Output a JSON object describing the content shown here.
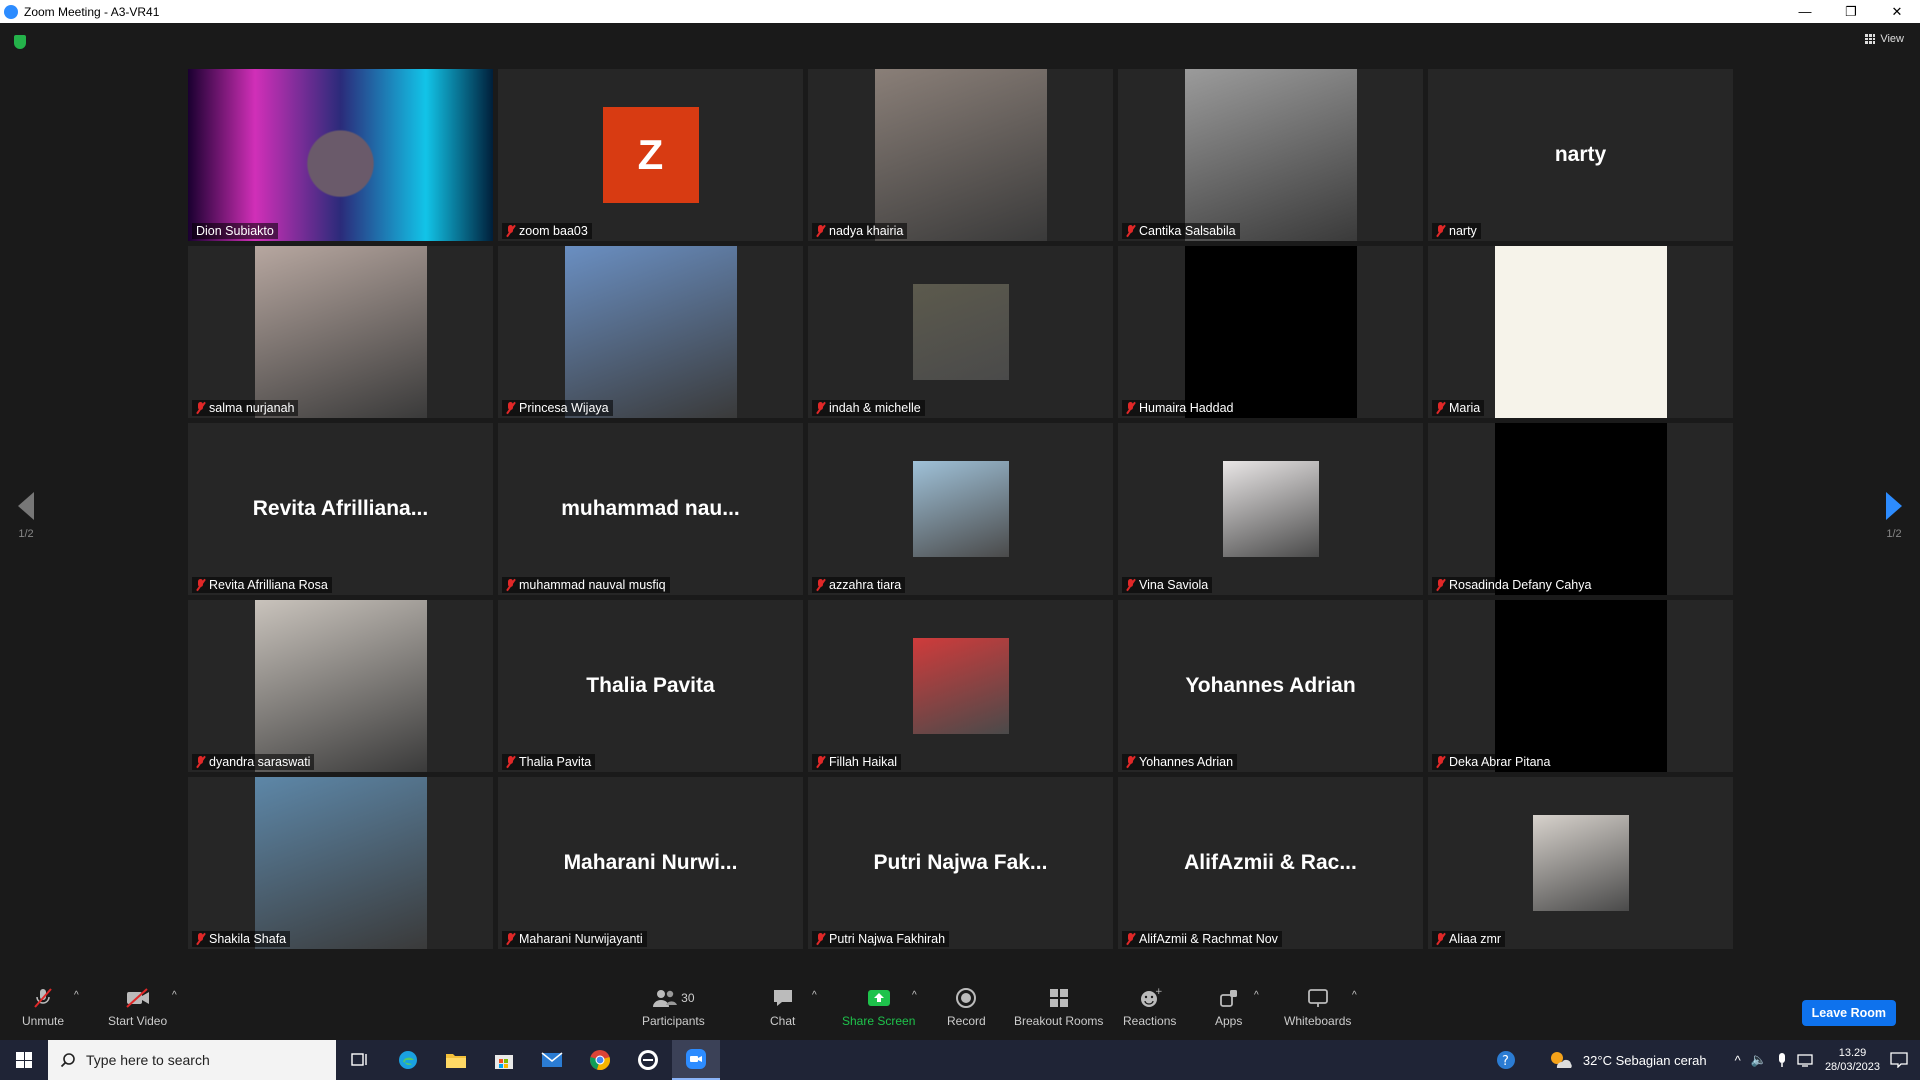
{
  "window": {
    "title": "Zoom Meeting - A3-VR41",
    "controls": [
      "—",
      "❐",
      "✕"
    ]
  },
  "header": {
    "view_label": "View"
  },
  "pager": {
    "left": "1/2",
    "right": "1/2"
  },
  "participants": [
    {
      "name": "Dion Subiakto",
      "display": "",
      "type": "video-neon",
      "muted": false,
      "active": true
    },
    {
      "name": "zoom baa03",
      "display": "",
      "type": "avatar",
      "initial": "Z",
      "muted": true
    },
    {
      "name": "nadya khairia",
      "display": "",
      "type": "video",
      "color": "#8a7f78",
      "muted": true
    },
    {
      "name": "Cantika Salsabila",
      "display": "",
      "type": "video",
      "color": "#9b9b9b",
      "muted": true
    },
    {
      "name": "narty",
      "display": "narty",
      "type": "text",
      "muted": true
    },
    {
      "name": "salma nurjanah",
      "display": "",
      "type": "video",
      "color": "#b7a7a0",
      "muted": true
    },
    {
      "name": "Princesa Wijaya",
      "display": "",
      "type": "video",
      "color": "#6a8fc2",
      "muted": true
    },
    {
      "name": "indah & michelle",
      "display": "",
      "type": "thumb",
      "color": "#5c5a4d",
      "muted": true
    },
    {
      "name": "Humaira Haddad",
      "display": "",
      "type": "black",
      "muted": true
    },
    {
      "name": "Maria",
      "display": "",
      "type": "cream",
      "muted": true
    },
    {
      "name": "Revita Afrilliana Rosa",
      "display": "Revita  Afrilliana...",
      "type": "text",
      "muted": true
    },
    {
      "name": "muhammad nauval musfiq",
      "display": "muhammad  nau...",
      "type": "text",
      "muted": true
    },
    {
      "name": "azzahra tiara",
      "display": "",
      "type": "thumb",
      "color": "#9fc1d8",
      "muted": true
    },
    {
      "name": "Vina Saviola",
      "display": "",
      "type": "thumb",
      "color": "#e9e6e6",
      "muted": true
    },
    {
      "name": "Rosadinda Defany Cahya",
      "display": "",
      "type": "black",
      "muted": true
    },
    {
      "name": "dyandra saraswati",
      "display": "",
      "type": "video",
      "color": "#c9c3bc",
      "muted": true
    },
    {
      "name": "Thalia Pavita",
      "display": "Thalia Pavita",
      "type": "text",
      "muted": true
    },
    {
      "name": "Fillah Haikal",
      "display": "",
      "type": "thumb",
      "color": "#cf3b3b",
      "muted": true
    },
    {
      "name": "Yohannes Adrian",
      "display": "Yohannes Adrian",
      "type": "text",
      "muted": true
    },
    {
      "name": "Deka Abrar Pitana",
      "display": "",
      "type": "black",
      "muted": true
    },
    {
      "name": "Shakila Shafa",
      "display": "",
      "type": "video",
      "color": "#5d87a8",
      "muted": true
    },
    {
      "name": "Maharani Nurwijayanti",
      "display": "Maharani  Nurwi...",
      "type": "text",
      "muted": true
    },
    {
      "name": "Putri Najwa Fakhirah",
      "display": "Putri Najwa Fak...",
      "type": "text",
      "muted": true
    },
    {
      "name": "AlifAzmii & Rachmat Nov",
      "display": "AlifAzmii & Rac...",
      "type": "text",
      "muted": true
    },
    {
      "name": "Aliaa zmr",
      "display": "",
      "type": "thumb",
      "color": "#d7d2cc",
      "muted": true
    }
  ],
  "toolbar": {
    "unmute": "Unmute",
    "start_video": "Start Video",
    "participants": "Participants",
    "participants_count": "30",
    "chat": "Chat",
    "share_screen": "Share Screen",
    "record": "Record",
    "breakout_rooms": "Breakout Rooms",
    "reactions": "Reactions",
    "apps": "Apps",
    "whiteboards": "Whiteboards",
    "leave": "Leave Room"
  },
  "taskbar": {
    "search_placeholder": "Type here to search",
    "weather": "32°C  Sebagian cerah",
    "time": "13.29",
    "date": "28/03/2023"
  },
  "colors": {
    "accent": "#0e72ed",
    "share": "#1ec24b",
    "muted": "#e02828",
    "active_border": "#e6e66a"
  }
}
